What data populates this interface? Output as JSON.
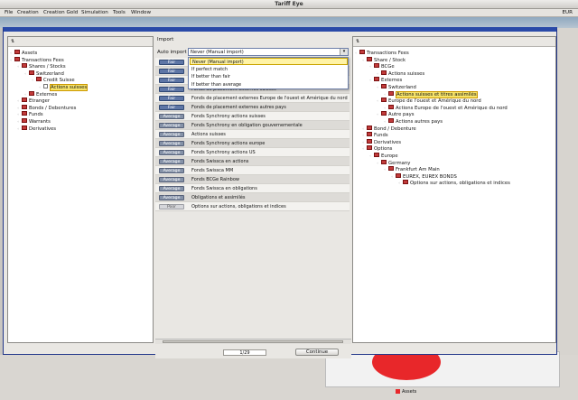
{
  "window": {
    "title": "Tariff Eye"
  },
  "menu": {
    "items": [
      "File",
      "Creation",
      "Creation Gold",
      "Simulation",
      "Tools",
      "Window"
    ],
    "currency": "EUR"
  },
  "left_tree": [
    {
      "label": "Assets",
      "level": 0
    },
    {
      "label": "Transactions Fees",
      "level": 0
    },
    {
      "label": "Shares / Stocks",
      "level": 1
    },
    {
      "label": "Switzerland",
      "level": 2
    },
    {
      "label": "Credit Suisse",
      "level": 3
    },
    {
      "label": "Actions suisses",
      "level": 4,
      "highlight": true
    },
    {
      "label": "Externes",
      "level": 2
    },
    {
      "label": "Etranger",
      "level": 1
    },
    {
      "label": "Bonds / Debentures",
      "level": 1
    },
    {
      "label": "Funds",
      "level": 1
    },
    {
      "label": "Warrants",
      "level": 1
    },
    {
      "label": "Derivatives",
      "level": 1
    }
  ],
  "import": {
    "header_label": "Import",
    "auto_import_label": "Auto import",
    "selected_value": "Never (Manual import)",
    "options": [
      "Never (Manual import)",
      "If perfect match",
      "If better than fair",
      "If better than average"
    ],
    "rows": [
      {
        "quality": "Fair",
        "text": ""
      },
      {
        "quality": "Fair",
        "text": ""
      },
      {
        "quality": "Fair",
        "text": ""
      },
      {
        "quality": "Fair",
        "text": "Fonds de placement externes suisses"
      },
      {
        "quality": "Fair",
        "text": "Fonds de placement externes Europe de l'ouest et Amérique du nord"
      },
      {
        "quality": "Fair",
        "text": "Fonds de placement externes autres pays"
      },
      {
        "quality": "Average",
        "text": "Fonds Synchrony actions suisses"
      },
      {
        "quality": "Average",
        "text": "Fonds Synchrony en obligation gouvernementale"
      },
      {
        "quality": "Average",
        "text": "Actions suisses"
      },
      {
        "quality": "Average",
        "text": "Fonds Synchrony actions europe"
      },
      {
        "quality": "Average",
        "text": "Fonds Synchrony actions US"
      },
      {
        "quality": "Average",
        "text": "Fonds Swissca en actions"
      },
      {
        "quality": "Average",
        "text": "Fonds Swissca MM"
      },
      {
        "quality": "Average",
        "text": "Fonds BCGe Rainbow"
      },
      {
        "quality": "Average",
        "text": "Fonds Swissca en obligations"
      },
      {
        "quality": "Average",
        "text": "Obligations et assimilés"
      },
      {
        "quality": "Poor",
        "text": "Options sur actions, obligations et indices"
      }
    ],
    "counter": "1/29",
    "continue_label": "Continue"
  },
  "right_tree": [
    {
      "label": "Transactions Fees",
      "level": 0
    },
    {
      "label": "Share / Stock",
      "level": 1
    },
    {
      "label": "BCGe",
      "level": 2
    },
    {
      "label": "Actions suisses",
      "level": 3
    },
    {
      "label": "Externes",
      "level": 2
    },
    {
      "label": "Switzerland",
      "level": 3
    },
    {
      "label": "Actions suisses et titres assimilés",
      "level": 4,
      "highlight": true
    },
    {
      "label": "Europe de l'ouest et Amérique du nord",
      "level": 3
    },
    {
      "label": "Actions Europe de l'ouest et Amérique du nord",
      "level": 4
    },
    {
      "label": "Autre pays",
      "level": 3
    },
    {
      "label": "Actions autres pays",
      "level": 4
    },
    {
      "label": "Bond / Debenture",
      "level": 1
    },
    {
      "label": "Funds",
      "level": 1
    },
    {
      "label": "Derivatives",
      "level": 1
    },
    {
      "label": "Options",
      "level": 1
    },
    {
      "label": "Europe",
      "level": 2
    },
    {
      "label": "Germany",
      "level": 3
    },
    {
      "label": "Frankfurt Am Main",
      "level": 4
    },
    {
      "label": "EUREX, EUREX BONDS",
      "level": 5
    },
    {
      "label": "Options sur actions, obligations et indices",
      "level": 6
    }
  ],
  "background": {
    "legend_label": "Assets",
    "accent_color": "#e8272a"
  }
}
